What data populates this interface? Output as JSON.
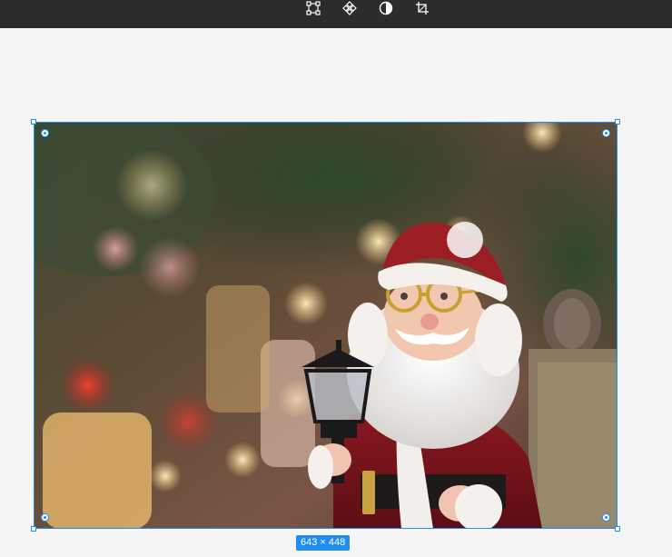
{
  "toolbar": {
    "tools": [
      {
        "name": "transform-icon",
        "color": "#ffffff"
      },
      {
        "name": "component-icon",
        "color": "#ffffff"
      },
      {
        "name": "contrast-icon",
        "color": "#ffffff"
      },
      {
        "name": "crop-icon",
        "color": "#ffffff"
      }
    ],
    "background": "#2c2c2c"
  },
  "canvas": {
    "background": "#f5f5f5"
  },
  "selection": {
    "accent_color": "#1e8ef0",
    "dimension_label": "643 × 448"
  },
  "image": {
    "subject": "santa-claus-figurine-with-lantern"
  }
}
